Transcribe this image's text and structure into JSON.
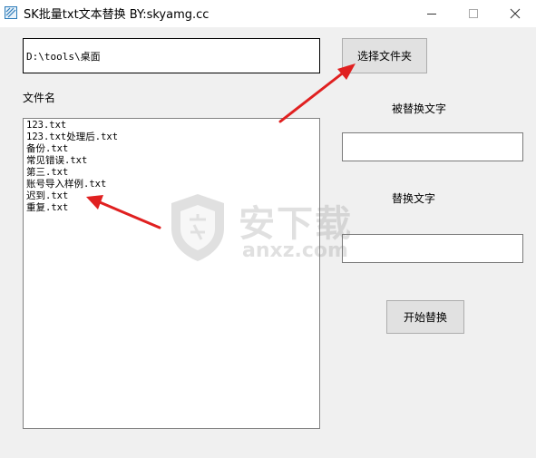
{
  "window": {
    "title": "SK批量txt文本替换 BY:skyamg.cc"
  },
  "folder": {
    "path_value": "D:\\tools\\桌面",
    "choose_button": "选择文件夹"
  },
  "file_list": {
    "label": "文件名",
    "items": [
      "123.txt",
      "123.txt处理后.txt",
      "备份.txt",
      "常见错误.txt",
      "第三.txt",
      "账号导入样例.txt",
      "迟到.txt",
      "重复.txt"
    ]
  },
  "replace_panel": {
    "replaced_label": "被替换文字",
    "replaced_value": "",
    "replacement_label": "替换文字",
    "replacement_value": "",
    "start_button": "开始替换"
  },
  "watermark": {
    "text": "安下载",
    "url": "anxz.com"
  },
  "colors": {
    "arrow": "#e02020",
    "button_face": "#e1e1e1",
    "window_bg": "#f0f0f0"
  }
}
